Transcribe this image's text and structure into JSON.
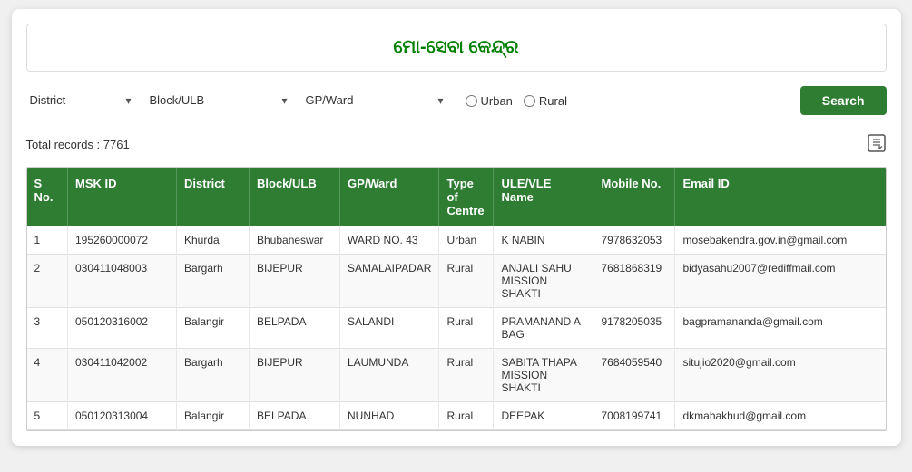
{
  "app": {
    "title": "ମୋ-ସେବା କେନ୍ଦ୍ର"
  },
  "filters": {
    "district_placeholder": "District",
    "block_ulb_placeholder": "Block/ULB",
    "gp_ward_placeholder": "GP/Ward",
    "urban_label": "Urban",
    "rural_label": "Rural",
    "search_label": "Search"
  },
  "table": {
    "total_records_label": "Total records : 7761",
    "columns": [
      "S No.",
      "MSK ID",
      "District",
      "Block/ULB",
      "GP/Ward",
      "Type of Centre",
      "ULE/VLE Name",
      "Mobile No.",
      "Email ID"
    ],
    "rows": [
      {
        "sno": "1",
        "msk_id": "195260000072",
        "district": "Khurda",
        "block_ulb": "Bhubaneswar",
        "gp_ward": "WARD NO. 43",
        "type": "Urban",
        "ule_vle_name": "K NABIN",
        "mobile": "7978632053",
        "email": "mosebakendra.gov.in@gmail.com"
      },
      {
        "sno": "2",
        "msk_id": "030411048003",
        "district": "Bargarh",
        "block_ulb": "BIJEPUR",
        "gp_ward": "SAMALAIPADAR",
        "type": "Rural",
        "ule_vle_name": "ANJALI SAHU MISSION SHAKTI",
        "mobile": "7681868319",
        "email": "bidyasahu2007@rediffmail.com"
      },
      {
        "sno": "3",
        "msk_id": "050120316002",
        "district": "Balangir",
        "block_ulb": "BELPADA",
        "gp_ward": "SALANDI",
        "type": "Rural",
        "ule_vle_name": "PRAMANAND A BAG",
        "mobile": "9178205035",
        "email": "bagpramananda@gmail.com"
      },
      {
        "sno": "4",
        "msk_id": "030411042002",
        "district": "Bargarh",
        "block_ulb": "BIJEPUR",
        "gp_ward": "LAUMUNDA",
        "type": "Rural",
        "ule_vle_name": "SABITA THAPA MISSION SHAKTI",
        "mobile": "7684059540",
        "email": "situjio2020@gmail.com"
      },
      {
        "sno": "5",
        "msk_id": "050120313004",
        "district": "Balangir",
        "block_ulb": "BELPADA",
        "gp_ward": "NUNHAD",
        "type": "Rural",
        "ule_vle_name": "DEEPAK",
        "mobile": "7008199741",
        "email": "dkmahakhud@gmail.com"
      }
    ]
  }
}
